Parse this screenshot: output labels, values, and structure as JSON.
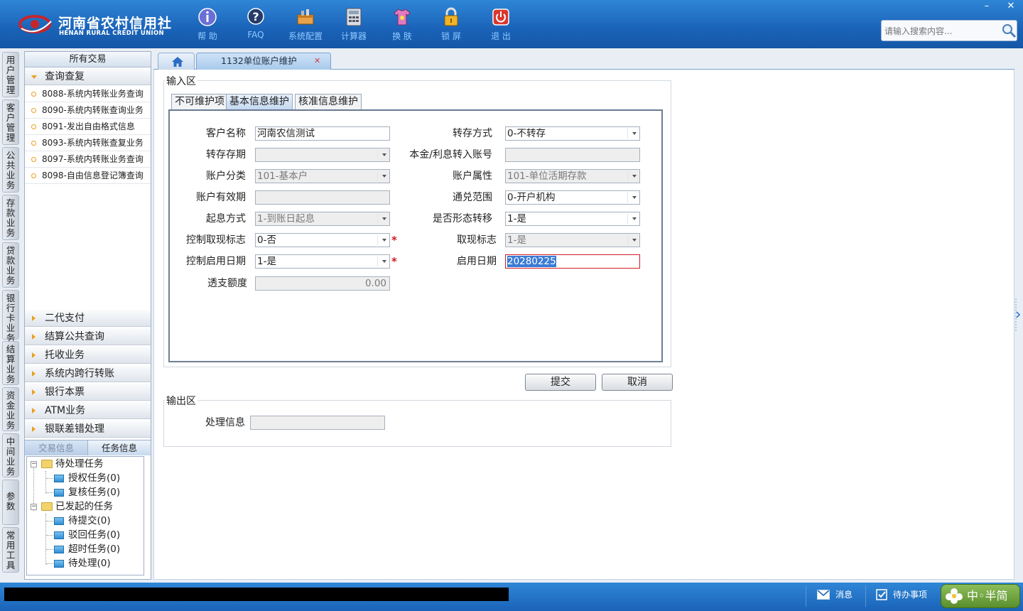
{
  "colors": {
    "brand_blue": "#1a63b8",
    "accent_orange": "#e8a020",
    "required_red": "#d01c24",
    "logo_red": "#c8252b"
  },
  "logo": {
    "cn": "河南省农村信用社",
    "en": "HENAN RURAL CREDIT UNION"
  },
  "toolbar": [
    {
      "label": "帮 助",
      "icon": "info-icon"
    },
    {
      "label": "FAQ",
      "icon": "question-icon"
    },
    {
      "label": "系统配置",
      "icon": "toolbox-icon"
    },
    {
      "label": "计算器",
      "icon": "calculator-icon"
    },
    {
      "label": "换 肤",
      "icon": "shirt-icon"
    },
    {
      "label": "锁 屏",
      "icon": "lock-icon"
    },
    {
      "label": "退 出",
      "icon": "power-icon"
    }
  ],
  "window": {
    "minimize": "–",
    "close": "✕"
  },
  "search": {
    "placeholder": "请输入搜索内容..."
  },
  "vtabs": [
    "用户管理",
    "客户管理",
    "公共业务",
    "存款业务",
    "贷款业务",
    "银行卡业务",
    "结算业务",
    "资金业务",
    "中间业务",
    "参数",
    "常用工具"
  ],
  "menu": {
    "title": "所有交易",
    "open_group": "查询查复",
    "items": [
      "8088-系统内转账业务查询",
      "8090-系统内转账查询业务",
      "8091-发出自由格式信息",
      "8093-系统内转账查复业务",
      "8097-系统内转账业务查询",
      "8098-自由信息登记簿查询"
    ],
    "groups": [
      "二代支付",
      "结算公共查询",
      "托收业务",
      "系统内跨行转账",
      "银行本票",
      "ATM业务",
      "银联差错处理"
    ],
    "task_tabs": [
      "交易信息",
      "任务信息"
    ],
    "tree": {
      "pending": "待处理任务",
      "pending_children": [
        "授权任务(0)",
        "复核任务(0)"
      ],
      "launched": "已发起的任务",
      "launched_children": [
        "待提交(0)",
        "驳回任务(0)",
        "超时任务(0)",
        "待处理(0)"
      ]
    }
  },
  "tabs": {
    "doc_title": "1132单位账户维护",
    "close": "✕"
  },
  "input_area": {
    "legend": "输入区",
    "inner_tabs": [
      "不可维护项",
      "基本信息维护",
      "核准信息维护"
    ],
    "fields": {
      "customer_name": {
        "label": "客户名称",
        "value": "河南农信测试"
      },
      "transfer_mode": {
        "label": "转存方式",
        "value": "0-不转存"
      },
      "transfer_term": {
        "label": "转存存期",
        "value": ""
      },
      "principal_account": {
        "label": "本金/利息转入账号",
        "value": ""
      },
      "account_class": {
        "label": "账户分类",
        "value": "101-基本户"
      },
      "account_attr": {
        "label": "账户属性",
        "value": "101-单位活期存款"
      },
      "account_validity": {
        "label": "账户有效期",
        "value": ""
      },
      "exchange_scope": {
        "label": "通兑范围",
        "value": "0-开户机构"
      },
      "interest_mode": {
        "label": "起息方式",
        "value": "1-到账日起息"
      },
      "form_transfer": {
        "label": "是否形态转移",
        "value": "1-是"
      },
      "withdraw_ctrl": {
        "label": "控制取现标志",
        "value": "0-否"
      },
      "withdraw_flag": {
        "label": "取现标志",
        "value": "1-是"
      },
      "date_ctrl": {
        "label": "控制启用日期",
        "value": "1-是"
      },
      "start_date": {
        "label": "启用日期",
        "value": "20280225"
      },
      "overdraft": {
        "label": "透支额度",
        "value": "0.00"
      }
    },
    "required_mark": "*"
  },
  "buttons": {
    "submit": "提交",
    "cancel": "取消"
  },
  "output_area": {
    "legend": "输出区",
    "process_label": "处理信息",
    "process_value": ""
  },
  "statusbar": {
    "message": "消息",
    "todo": "待办事项",
    "ime": "中◦半简"
  }
}
